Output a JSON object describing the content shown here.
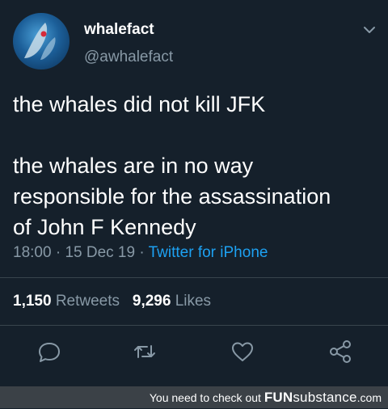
{
  "author": {
    "name": "whalefact",
    "handle": "@awhalefact"
  },
  "tweet": {
    "line1": "the whales did not kill JFK",
    "line2": "the whales are in no way",
    "line3": "responsible for the assassination",
    "line4": "of John F Kennedy"
  },
  "meta": {
    "time": "18:00",
    "date": "15 Dec 19",
    "source": "Twitter for iPhone",
    "separator": "·"
  },
  "stats": {
    "retweets_count": "1,150",
    "retweets_label": "Retweets",
    "likes_count": "9,296",
    "likes_label": "Likes"
  },
  "footer": {
    "text": "You need to check out",
    "brand_bold": "FUN",
    "brand_rest": "substance",
    "brand_suffix": ".com"
  },
  "colors": {
    "background": "#15202b",
    "muted": "#8899a6",
    "link": "#1da1f2",
    "divider": "#38444d"
  },
  "icons": [
    "chevron-down-icon",
    "reply-icon",
    "retweet-icon",
    "like-icon",
    "share-icon"
  ]
}
